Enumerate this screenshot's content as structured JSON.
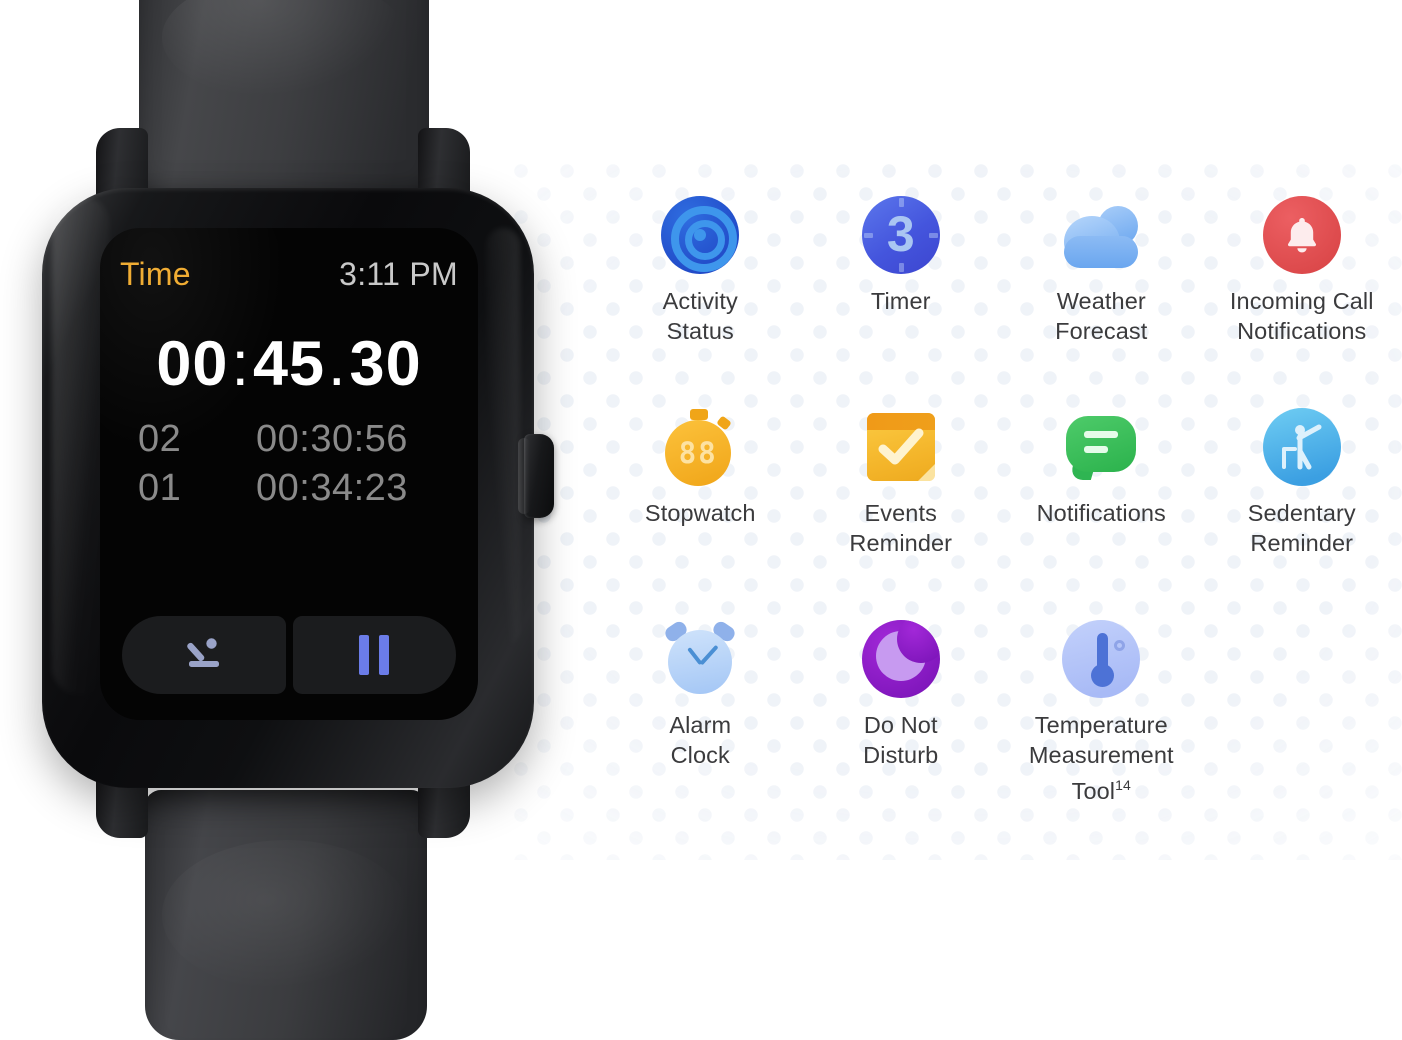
{
  "watch": {
    "display": {
      "status_title": "Time",
      "clock": "3:11 PM",
      "elapsed": {
        "minutes": "00",
        "minute_second_separator": ":",
        "seconds": "45",
        "second_fraction_separator": ".",
        "fraction": "30"
      },
      "laps": [
        {
          "index": "02",
          "time": "00:30:56"
        },
        {
          "index": "01",
          "time": "00:34:23"
        }
      ],
      "controls": [
        {
          "name": "lap-button",
          "icon": "lap-flag-icon"
        },
        {
          "name": "pause-button",
          "icon": "pause-icon"
        }
      ]
    },
    "hardware": {
      "crown_button": "crown-button",
      "strap_top": "watch-strap-top",
      "strap_bottom": "watch-strap-bottom"
    }
  },
  "features": [
    {
      "label": "Activity Status",
      "label_line1": "Activity",
      "label_line2": "Status",
      "icon": "activity-rings-icon",
      "color": "#2f6de0"
    },
    {
      "label": "Timer",
      "label_line1": "Timer",
      "label_line2": "",
      "icon": "timer-icon",
      "color": "#4455dd",
      "badge": "3"
    },
    {
      "label": "Weather Forecast",
      "label_line1": "Weather",
      "label_line2": "Forecast",
      "icon": "cloud-icon",
      "color": "#6aa6ef"
    },
    {
      "label": "Incoming Call Notifications",
      "label_line1": "Incoming Call",
      "label_line2": "Notifications",
      "icon": "bell-icon",
      "color": "#da4648"
    },
    {
      "label": "Stopwatch",
      "label_line1": "Stopwatch",
      "label_line2": "",
      "icon": "stopwatch-icon",
      "color": "#f0a518",
      "badge": "88"
    },
    {
      "label": "Events Reminder",
      "label_line1": "Events",
      "label_line2": "Reminder",
      "icon": "calendar-check-icon",
      "color": "#f4b52a"
    },
    {
      "label": "Notifications",
      "label_line1": "Notifications",
      "label_line2": "",
      "icon": "chat-bubble-icon",
      "color": "#2bb24c"
    },
    {
      "label": "Sedentary Reminder",
      "label_line1": "Sedentary",
      "label_line2": "Reminder",
      "icon": "stretching-person-icon",
      "color": "#3b9fe2"
    },
    {
      "label": "Alarm Clock",
      "label_line1": "Alarm",
      "label_line2": "Clock",
      "icon": "alarm-clock-icon",
      "color": "#a3c6f5"
    },
    {
      "label": "Do Not Disturb",
      "label_line1": "Do Not",
      "label_line2": "Disturb",
      "icon": "crescent-moon-icon",
      "color": "#7b14b8"
    },
    {
      "label": "Temperature Measurement Tool",
      "label_line1": "Temperature",
      "label_line2": "Measurement Tool",
      "label_superscript": "14",
      "icon": "thermometer-icon",
      "color": "#4d72d6"
    }
  ]
}
